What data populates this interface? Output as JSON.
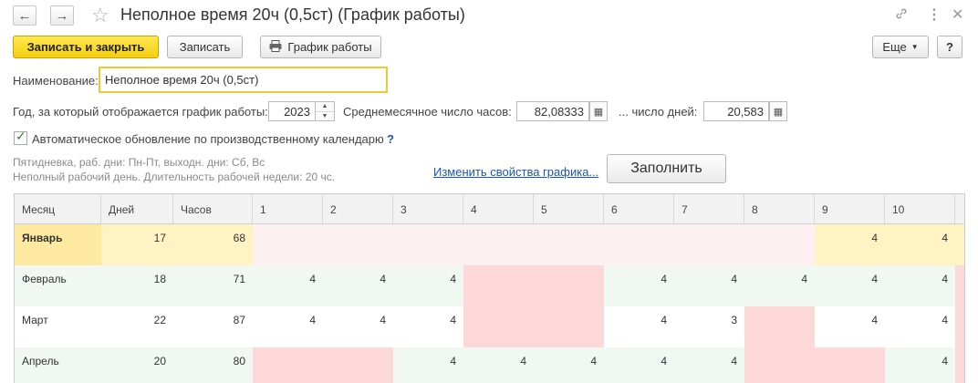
{
  "window": {
    "title": "Неполное время 20ч (0,5ст) (График работы)"
  },
  "icons": {
    "back": "arrow-left-icon",
    "forward": "arrow-right-icon",
    "favorite": "star-icon",
    "link": "link-icon",
    "more": "more-vertical-icon",
    "close": "close-icon",
    "print": "printer-icon",
    "calendar": "calendar-icon",
    "check": "checkmark-icon"
  },
  "toolbar": {
    "save_close": "Записать и закрыть",
    "save": "Записать",
    "schedule": "График работы",
    "more": "Еще",
    "help": "?"
  },
  "form": {
    "name_label": "Наименование:",
    "name_value": "Неполное время 20ч (0,5ст)",
    "year_label": "Год, за который отображается график работы:",
    "year_value": "2023",
    "avg_hours_label": "Среднемесячное число часов:",
    "avg_hours_value": "82,08333",
    "days_label": "... число дней:",
    "days_value": "20,583",
    "auto_update_label": "Автоматическое обновление по производственному календарю",
    "auto_help": "?",
    "info_line1": "Пятидневка, раб. дни: Пн-Пт, выходн. дни: Сб, Вс",
    "info_line2": "Неполный рабочий день. Длительность рабочей недели: 20 чс.",
    "change_link": "Изменить свойства графика...",
    "fill_button": "Заполнить"
  },
  "colors": {
    "accent": "#f5cf10",
    "link": "#1a56b0",
    "weekend": "#fcd8d8",
    "weekend_light": "#fdf0f0",
    "selected": "#fde9a0",
    "row_alt": "#f1f8f1"
  },
  "table": {
    "headers": [
      "Месяц",
      "Дней",
      "Часов",
      "1",
      "2",
      "3",
      "4",
      "5",
      "6",
      "7",
      "8",
      "9",
      "10"
    ],
    "rows": [
      {
        "month": "Январь",
        "days": "17",
        "hours": "68",
        "cells": [
          "",
          "",
          "",
          "",
          "",
          "",
          "",
          "",
          "4",
          "4"
        ]
      },
      {
        "month": "Февраль",
        "days": "18",
        "hours": "71",
        "cells": [
          "4",
          "4",
          "4",
          "",
          "",
          "4",
          "4",
          "4",
          "4",
          "4"
        ]
      },
      {
        "month": "Март",
        "days": "22",
        "hours": "87",
        "cells": [
          "4",
          "4",
          "4",
          "",
          "",
          "4",
          "3",
          "",
          "4",
          "4"
        ]
      },
      {
        "month": "Апрель",
        "days": "20",
        "hours": "80",
        "cells": [
          "",
          "",
          "4",
          "4",
          "4",
          "4",
          "4",
          "",
          "",
          "4"
        ]
      }
    ]
  }
}
